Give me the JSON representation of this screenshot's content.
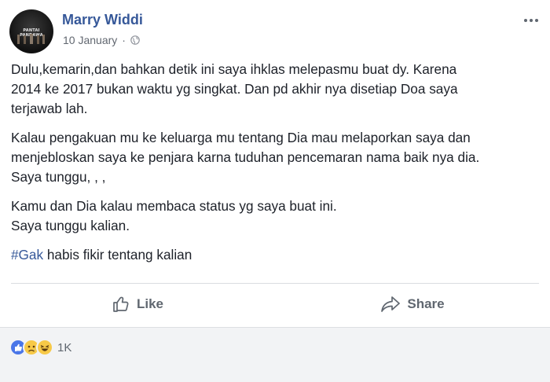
{
  "post": {
    "author": "Marry Widdi",
    "date": "10 January",
    "separator": "·",
    "avatar_text": "PANTAI PANDAWA",
    "paragraphs": [
      "Dulu,kemarin,dan bahkan detik ini saya ihklas melepasmu buat dy. Karena\n2014 ke 2017 bukan waktu yg singkat. Dan pd akhir nya disetiap Doa saya\nterjawab lah.",
      "Kalau pengakuan mu ke keluarga mu tentang Dia mau melaporkan saya dan\nmenjebloskan saya ke penjara karna tuduhan pencemaran nama baik nya dia.\nSaya tunggu, , ,",
      "Kamu dan Dia kalau membaca status yg saya buat ini.\nSaya tunggu kalian."
    ],
    "hashtag": "#Gak",
    "hashtag_rest": " habis fikir tentang kalian"
  },
  "actions": {
    "like_label": "Like",
    "share_label": "Share"
  },
  "reactions": {
    "count": "1K",
    "types": [
      "like",
      "sad",
      "haha"
    ]
  },
  "colors": {
    "author_blue": "#365899",
    "hashtag_blue": "#365899",
    "footer_bg": "#f2f3f5",
    "action_gray": "#606770"
  },
  "icons": {
    "globe": "globe-icon",
    "more": "more-icon",
    "like": "thumbs-up-icon",
    "share": "share-arrow-icon"
  }
}
